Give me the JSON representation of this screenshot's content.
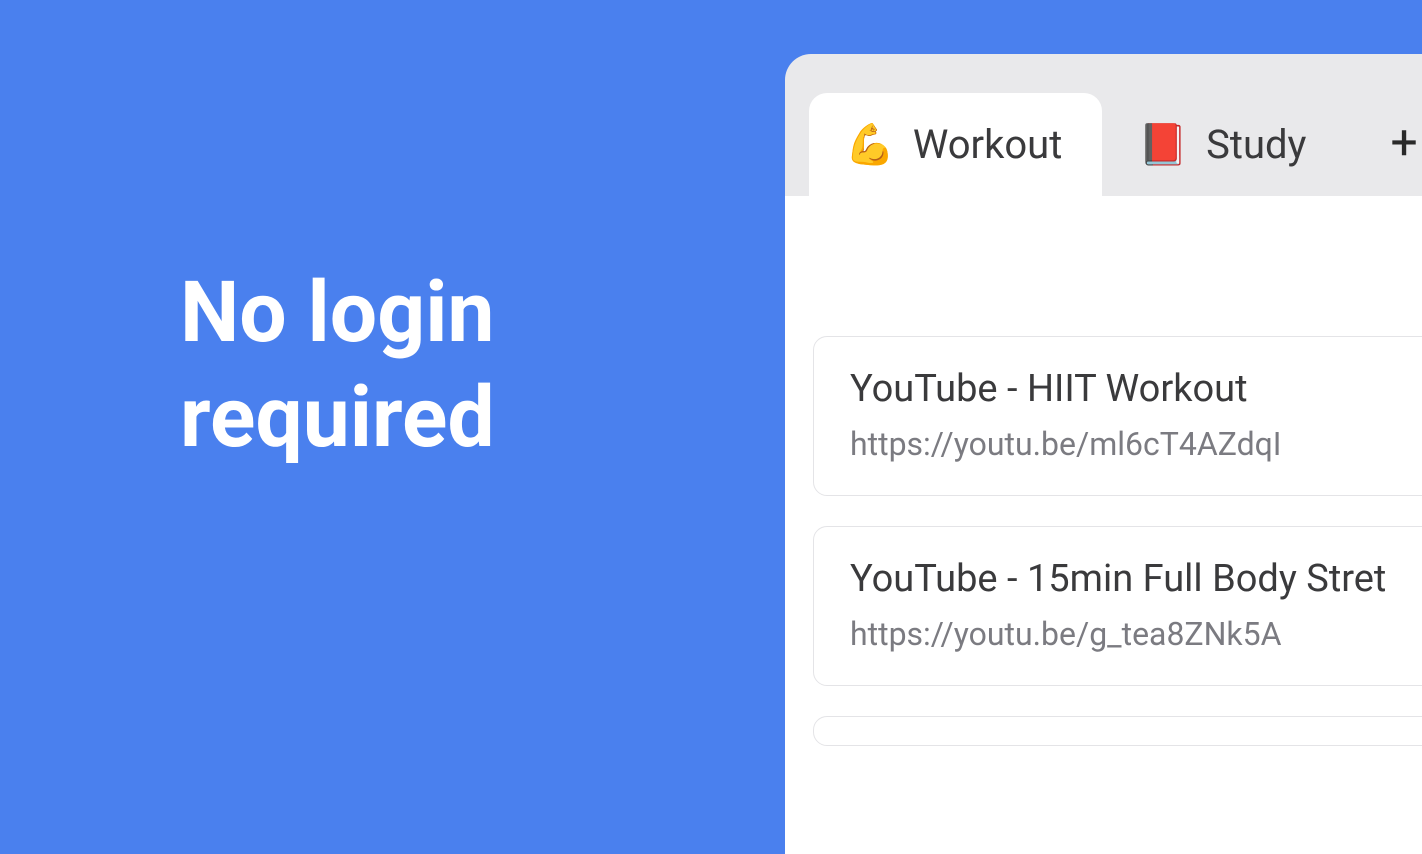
{
  "hero": {
    "line1": "No login",
    "line2": "required"
  },
  "tabs": [
    {
      "emoji": "💪",
      "label": "Workout",
      "active": true
    },
    {
      "emoji": "📕",
      "label": "Study",
      "active": false
    }
  ],
  "add_tab_label": "+",
  "links": [
    {
      "title": "YouTube - HIIT Workout",
      "url": "https://youtu.be/ml6cT4AZdqI"
    },
    {
      "title": "YouTube - 15min Full Body Stret",
      "url": "https://youtu.be/g_tea8ZNk5A"
    }
  ]
}
